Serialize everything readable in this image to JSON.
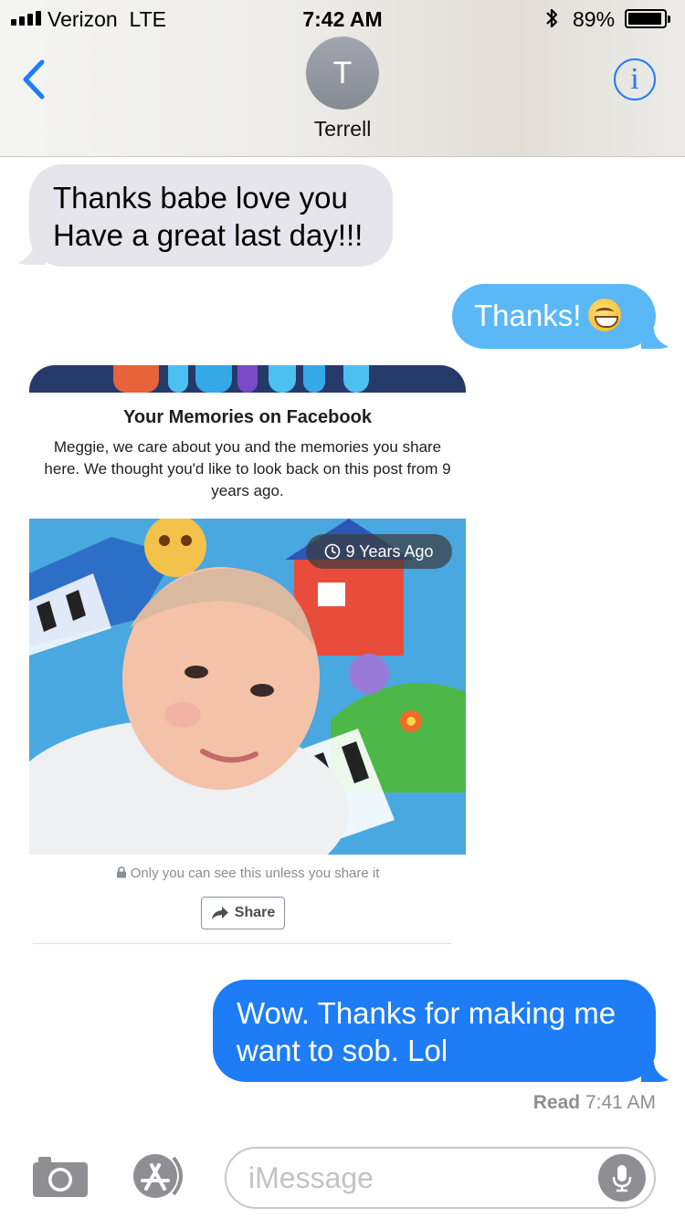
{
  "status_bar": {
    "carrier": "Verizon",
    "network": "LTE",
    "time": "7:42 AM",
    "battery_percent": "89%",
    "battery_level": 0.89,
    "icons": [
      "signal-icon",
      "bluetooth-icon",
      "battery-icon"
    ]
  },
  "header": {
    "avatar_initial": "T",
    "contact_name": "Terrell",
    "back_icon": "chevron-left-icon",
    "info_icon": "info-icon",
    "info_glyph": "i",
    "accent_color": "#1e7cf6"
  },
  "messages": [
    {
      "direction": "incoming",
      "text": "Thanks babe love you\nHave a great last day!!!"
    },
    {
      "direction": "outgoing",
      "text": "Thanks!",
      "emoji": "grinning-face-icon"
    },
    {
      "direction": "incoming",
      "type": "facebook-memory-card"
    },
    {
      "direction": "outgoing",
      "text": "Wow. Thanks for making me want to sob. Lol"
    }
  ],
  "card": {
    "title": "Your Memories on Facebook",
    "body": "Meggie, we care about you and the memories you share here. We thought you'd like to look back on this post from 9 years ago.",
    "age_label": "9 Years Ago",
    "privacy_note": "Only you can see this unless you share it",
    "share_label": "Share"
  },
  "receipt": {
    "label": "Read",
    "time": "7:41 AM"
  },
  "input_bar": {
    "placeholder": "iMessage",
    "icons": [
      "camera-icon",
      "app-store-icon",
      "microphone-icon"
    ]
  },
  "colors": {
    "incoming_bubble": "#e6e5eb",
    "outgoing_bubble": "#1e7cf6",
    "outgoing_bubble_light": "#5bb8f6"
  }
}
